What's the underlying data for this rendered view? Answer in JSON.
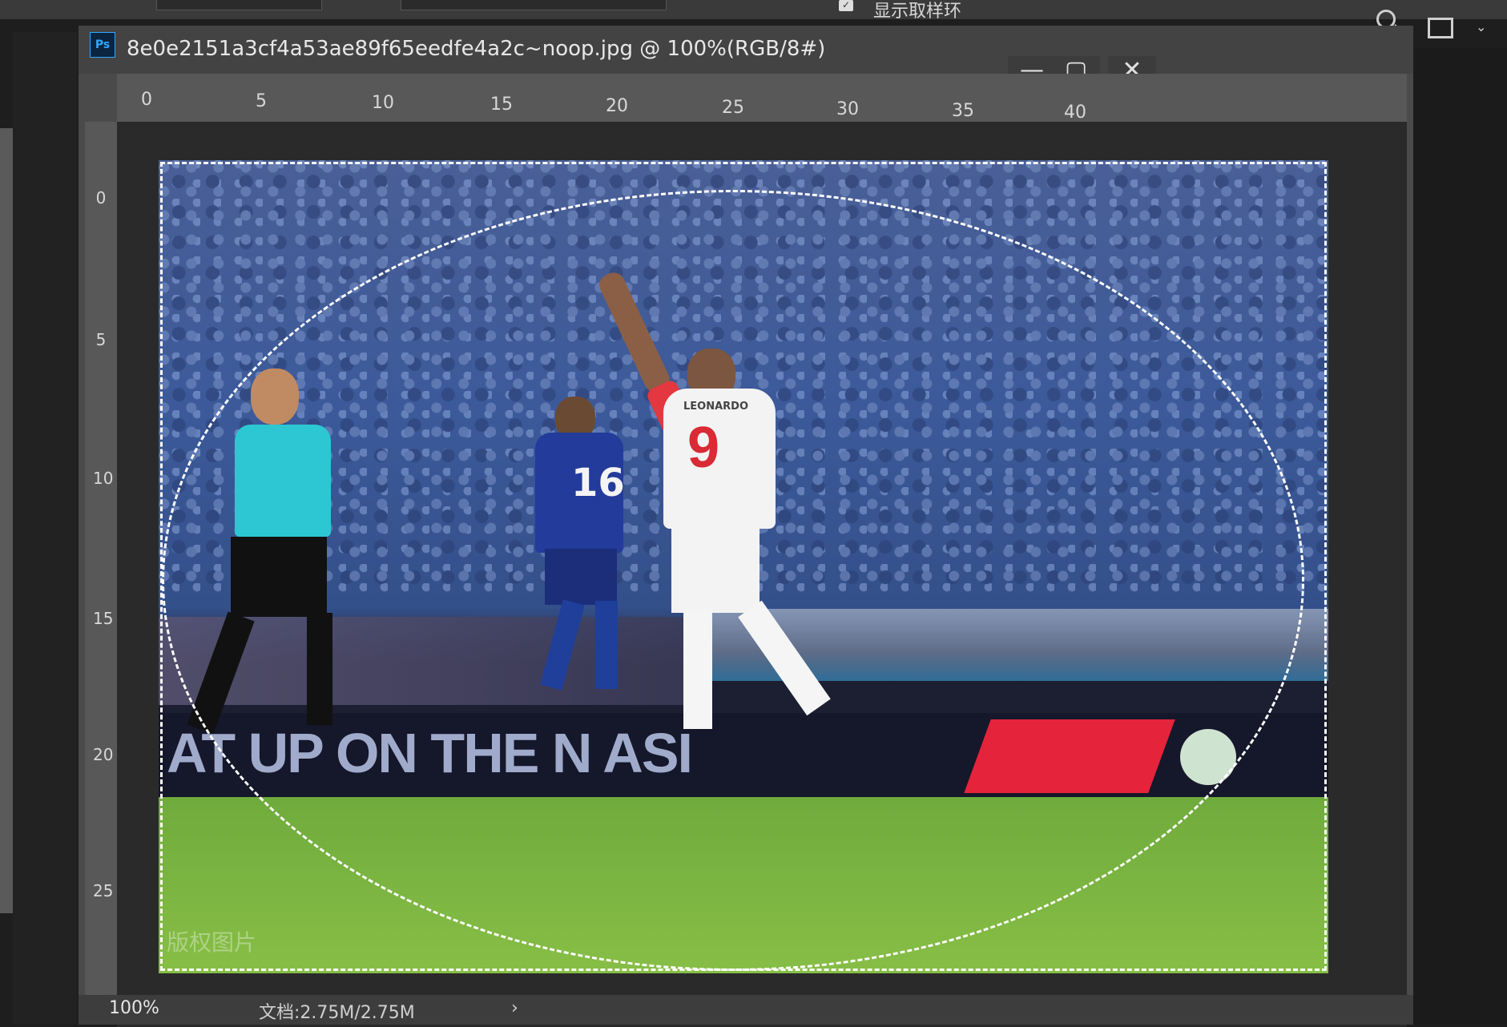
{
  "topbar": {
    "checkbox_label": "显示取样环",
    "checkbox_checked": "✓"
  },
  "document": {
    "title": "8e0e2151a3cf4a53ae89f65eedfe4a2c~noop.jpg @ 100%(RGB/8#)",
    "app_icon_label": "Ps",
    "window_buttons": {
      "minimize": "—",
      "maximize": "▢",
      "close": "✕"
    }
  },
  "rulers": {
    "horizontal": [
      "0",
      "5",
      "10",
      "15",
      "20",
      "25",
      "30",
      "35",
      "40"
    ],
    "vertical": [
      "0",
      "5",
      "10",
      "15",
      "20",
      "25"
    ]
  },
  "canvas": {
    "slogan_text": "AT UP ON THE N ASI",
    "white_player_name": "LEONARDO",
    "white_player_number": "9",
    "blue_player_number": "16",
    "watermark": "版权图片"
  },
  "status": {
    "zoom": "100%",
    "doc_size": "文档:2.75M/2.75M",
    "arrow": "›"
  },
  "colors": {
    "accent_ps": "#31a8ff",
    "jersey_red": "#d92a35",
    "referee_cyan": "#2cc7d2",
    "jersey_blue": "#233b9a"
  }
}
